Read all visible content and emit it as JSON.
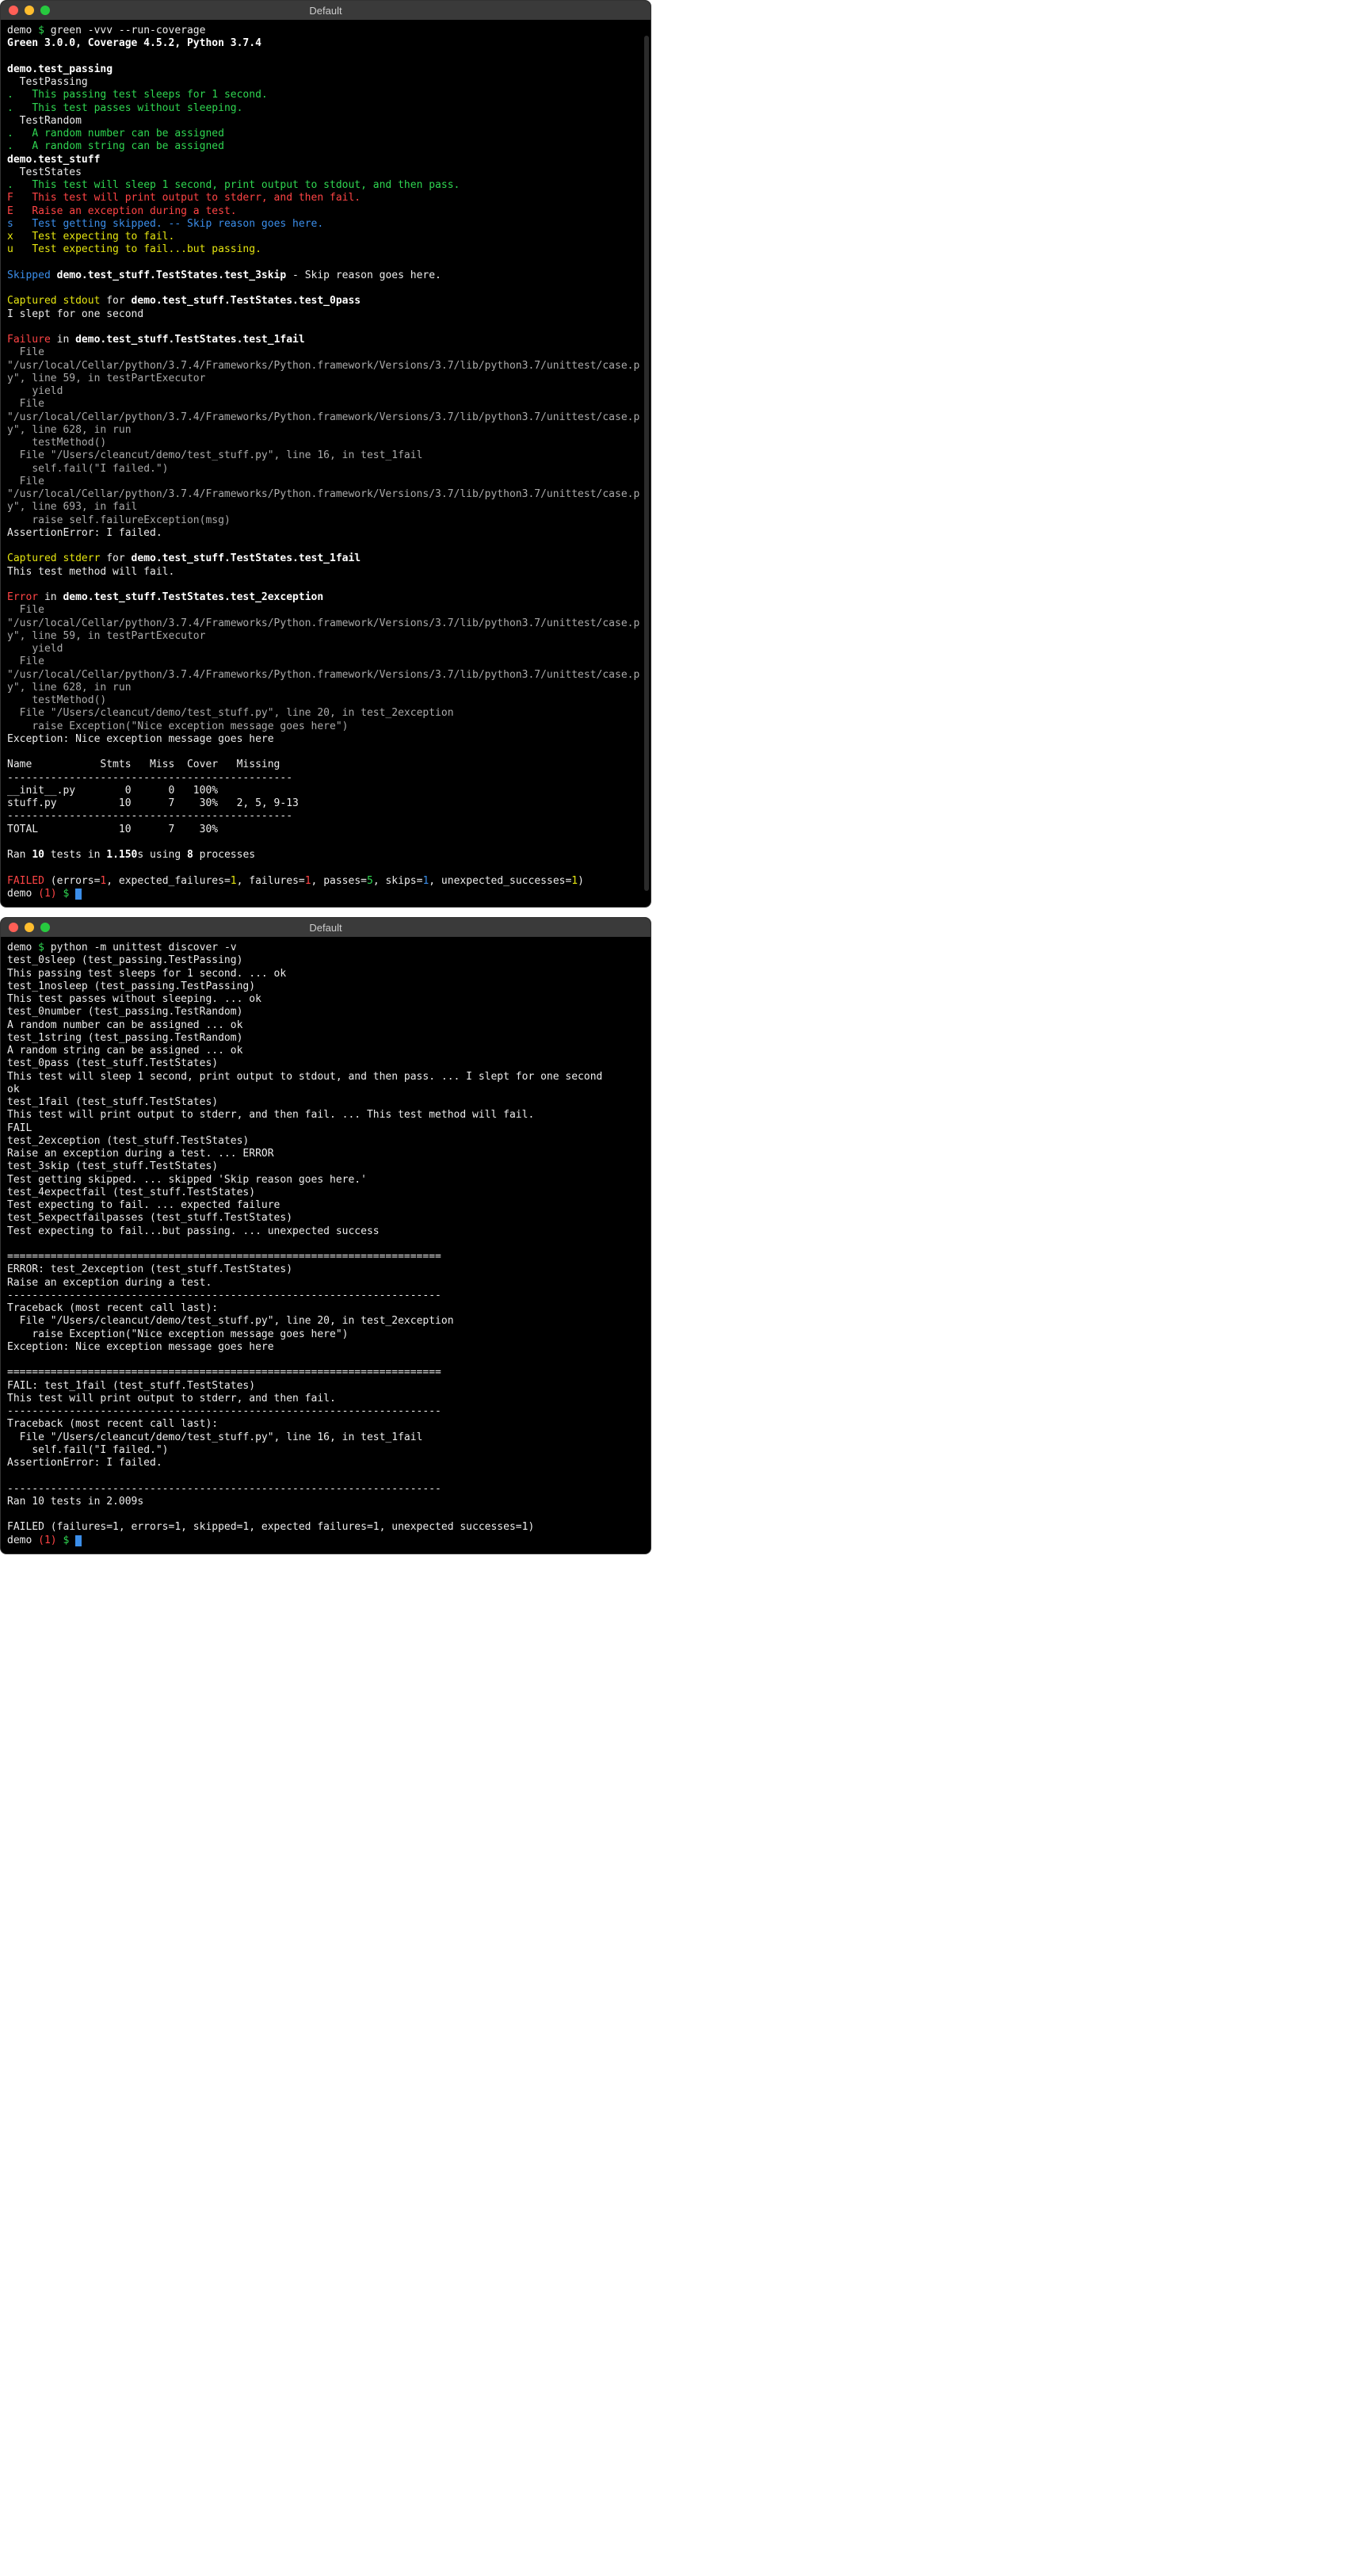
{
  "window1": {
    "title": "Default",
    "prompt_user": "demo",
    "prompt_sym": "$",
    "command": "green -vvv --run-coverage",
    "version_line": "Green 3.0.0, Coverage 4.5.2, Python 3.7.4",
    "module1": "demo.test_passing",
    "class1": "TestPassing",
    "pass1": "This passing test sleeps for 1 second.",
    "pass2": "This test passes without sleeping.",
    "class1b": "TestRandom",
    "pass3": "A random number can be assigned",
    "pass4": "A random string can be assigned",
    "module2": "demo.test_stuff",
    "class2": "TestStates",
    "pass5": "This test will sleep 1 second, print output to stdout, and then pass.",
    "fail1": "This test will print output to stderr, and then fail.",
    "err1": "Raise an exception during a test.",
    "skip1": "Test getting skipped.",
    "skip_suffix": "-- Skip reason goes here.",
    "xfail": "Test expecting to fail.",
    "uxpass": "Test expecting to fail...but passing.",
    "skipped_label": "Skipped",
    "skipped_target": "demo.test_stuff.TestStates.test_3skip",
    "skipped_reason": "- Skip reason goes here.",
    "captured_stdout": "Captured stdout",
    "captured_for": "for",
    "stdout_target": "demo.test_stuff.TestStates.test_0pass",
    "stdout_body": "I slept for one second",
    "failure_label": "Failure",
    "failure_in": "in",
    "failure_target": "demo.test_stuff.TestStates.test_1fail",
    "tb1_l1": "  File \"/usr/local/Cellar/python/3.7.4/Frameworks/Python.framework/Versions/3.7/lib/python3.7/unittest/case.py\", line 59, in testPartExecutor",
    "tb1_l2": "    yield",
    "tb1_l3": "  File \"/usr/local/Cellar/python/3.7.4/Frameworks/Python.framework/Versions/3.7/lib/python3.7/unittest/case.py\", line 628, in run",
    "tb1_l4": "    testMethod()",
    "tb1_l5": "  File \"/Users/cleancut/demo/test_stuff.py\", line 16, in test_1fail",
    "tb1_l6": "    self.fail(\"I failed.\")",
    "tb1_l7": "  File \"/usr/local/Cellar/python/3.7.4/Frameworks/Python.framework/Versions/3.7/lib/python3.7/unittest/case.py\", line 693, in fail",
    "tb1_l8": "    raise self.failureException(msg)",
    "tb1_l9": "AssertionError: I failed.",
    "captured_stderr": "Captured stderr",
    "stderr_target": "demo.test_stuff.TestStates.test_1fail",
    "stderr_body": "This test method will fail.",
    "error_label": "Error",
    "error_target": "demo.test_stuff.TestStates.test_2exception",
    "tb2_l1": "  File \"/usr/local/Cellar/python/3.7.4/Frameworks/Python.framework/Versions/3.7/lib/python3.7/unittest/case.py\", line 59, in testPartExecutor",
    "tb2_l2": "    yield",
    "tb2_l3": "  File \"/usr/local/Cellar/python/3.7.4/Frameworks/Python.framework/Versions/3.7/lib/python3.7/unittest/case.py\", line 628, in run",
    "tb2_l4": "    testMethod()",
    "tb2_l5": "  File \"/Users/cleancut/demo/test_stuff.py\", line 20, in test_2exception",
    "tb2_l6": "    raise Exception(\"Nice exception message goes here\")",
    "tb2_l7": "Exception: Nice exception message goes here",
    "cov_header": "Name           Stmts   Miss  Cover   Missing",
    "cov_sep": "----------------------------------------------",
    "cov_r1": "__init__.py        0      0   100%",
    "cov_r2": "stuff.py          10      7    30%   2, 5, 9-13",
    "cov_total": "TOTAL             10      7    30%",
    "ran_prefix": "Ran ",
    "ran_tests": "10",
    "ran_mid": " tests in ",
    "ran_time": "1.150",
    "ran_s": "s using ",
    "ran_procs": "8",
    "ran_suffix": " processes",
    "failed_label": "FAILED",
    "failed_stats": " (errors=1, expected_failures=1, failures=1, passes=5, skips=1, unexpected_successes=1)",
    "f_errors_k": "errors=",
    "f_errors_v": "1",
    "f_exf_k": ", expected_failures=",
    "f_exf_v": "1",
    "f_fail_k": ", failures=",
    "f_fail_v": "1",
    "f_pass_k": ", passes=",
    "f_pass_v": "5",
    "f_skip_k": ", skips=",
    "f_skip_v": "1",
    "f_unex_k": ", unexpected_successes=",
    "f_unex_v": "1",
    "prompt_exit": "demo (1) $ "
  },
  "window2": {
    "title": "Default",
    "prompt_user": "demo",
    "prompt_sym": "$",
    "command": "python -m unittest discover -v",
    "l01": "test_0sleep (test_passing.TestPassing)",
    "l02": "This passing test sleeps for 1 second. ... ok",
    "l03": "test_1nosleep (test_passing.TestPassing)",
    "l04": "This test passes without sleeping. ... ok",
    "l05": "test_0number (test_passing.TestRandom)",
    "l06": "A random number can be assigned ... ok",
    "l07": "test_1string (test_passing.TestRandom)",
    "l08": "A random string can be assigned ... ok",
    "l09": "test_0pass (test_stuff.TestStates)",
    "l10": "This test will sleep 1 second, print output to stdout, and then pass. ... I slept for one second",
    "l11": "ok",
    "l12": "test_1fail (test_stuff.TestStates)",
    "l13": "This test will print output to stderr, and then fail. ... This test method will fail.",
    "l14": "FAIL",
    "l15": "test_2exception (test_stuff.TestStates)",
    "l16": "Raise an exception during a test. ... ERROR",
    "l17": "test_3skip (test_stuff.TestStates)",
    "l18": "Test getting skipped. ... skipped 'Skip reason goes here.'",
    "l19": "test_4expectfail (test_stuff.TestStates)",
    "l20": "Test expecting to fail. ... expected failure",
    "l21": "test_5expectfailpasses (test_stuff.TestStates)",
    "l22": "Test expecting to fail...but passing. ... unexpected success",
    "sep_eq": "======================================================================",
    "err_head": "ERROR: test_2exception (test_stuff.TestStates)",
    "err_desc": "Raise an exception during a test.",
    "sep_dash": "----------------------------------------------------------------------",
    "tb_head": "Traceback (most recent call last):",
    "e_tb1": "  File \"/Users/cleancut/demo/test_stuff.py\", line 20, in test_2exception",
    "e_tb2": "    raise Exception(\"Nice exception message goes here\")",
    "e_tb3": "Exception: Nice exception message goes here",
    "fail_head": "FAIL: test_1fail (test_stuff.TestStates)",
    "fail_desc": "This test will print output to stderr, and then fail.",
    "f_tb1": "  File \"/Users/cleancut/demo/test_stuff.py\", line 16, in test_1fail",
    "f_tb2": "    self.fail(\"I failed.\")",
    "f_tb3": "AssertionError: I failed.",
    "ran": "Ran 10 tests in 2.009s",
    "failed": "FAILED (failures=1, errors=1, skipped=1, expected failures=1, unexpected successes=1)",
    "prompt_exit": "demo (1) $ "
  }
}
